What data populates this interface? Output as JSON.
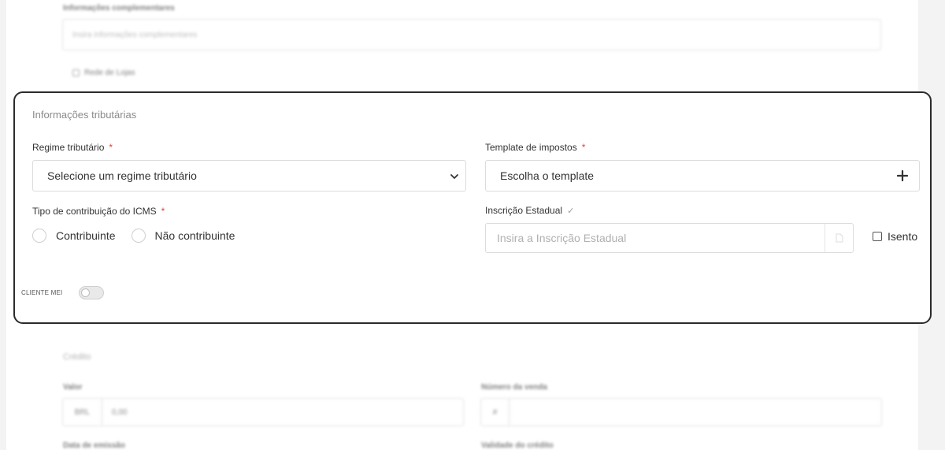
{
  "background_section": {
    "complementary_label": "Informações complementares",
    "complementary_placeholder": "Insira informações complementares",
    "store_network_label": "Rede de Lojas"
  },
  "tax_section": {
    "title": "Informações tributárias",
    "regime": {
      "label": "Regime tributário",
      "required_mark": "*",
      "selected_value": "Selecione um regime tributário"
    },
    "tax_template": {
      "label": "Template de impostos",
      "required_mark": "*",
      "value": "Escolha o template"
    },
    "icms": {
      "label": "Tipo de contribuição do ICMS",
      "required_mark": "*",
      "options": [
        "Contribuinte",
        "Não contribuinte"
      ]
    },
    "state_registration": {
      "label": "Inscrição Estadual",
      "check_mark": "✓",
      "placeholder": "Insira a Inscrição Estadual",
      "exempt_label": "Isento"
    },
    "mei": {
      "label": "CLIENTE MEI",
      "enabled": false
    }
  },
  "credit_section": {
    "title": "Crédito",
    "value_label": "Valor",
    "currency_prefix": "BRL",
    "value": "0,00",
    "sale_number_label": "Número da venda",
    "sale_number_prefix": "#",
    "issue_date_label": "Data de emissão",
    "validity_label": "Validade do crédito"
  }
}
